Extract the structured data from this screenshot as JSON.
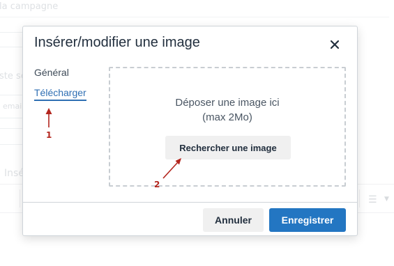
{
  "background": {
    "campaign_label": "la campagne",
    "test_label": "ste se",
    "email_placeholder": "emai",
    "insert_label": "Insé"
  },
  "modal": {
    "title": "Insérer/modifier une image",
    "close_icon": "×",
    "tabs": [
      {
        "label": "Général",
        "active": false
      },
      {
        "label": "Télécharger",
        "active": true
      }
    ],
    "dropzone": {
      "line1": "Déposer une image ici",
      "line2": "(max 2Mo)",
      "browse_label": "Rechercher une image"
    },
    "footer": {
      "cancel_label": "Annuler",
      "save_label": "Enregistrer"
    }
  },
  "annotations": [
    {
      "label": "1"
    },
    {
      "label": "2"
    }
  ],
  "colors": {
    "accent": "#2376c2",
    "link": "#2f6fb3",
    "annotation": "#b3261e"
  }
}
